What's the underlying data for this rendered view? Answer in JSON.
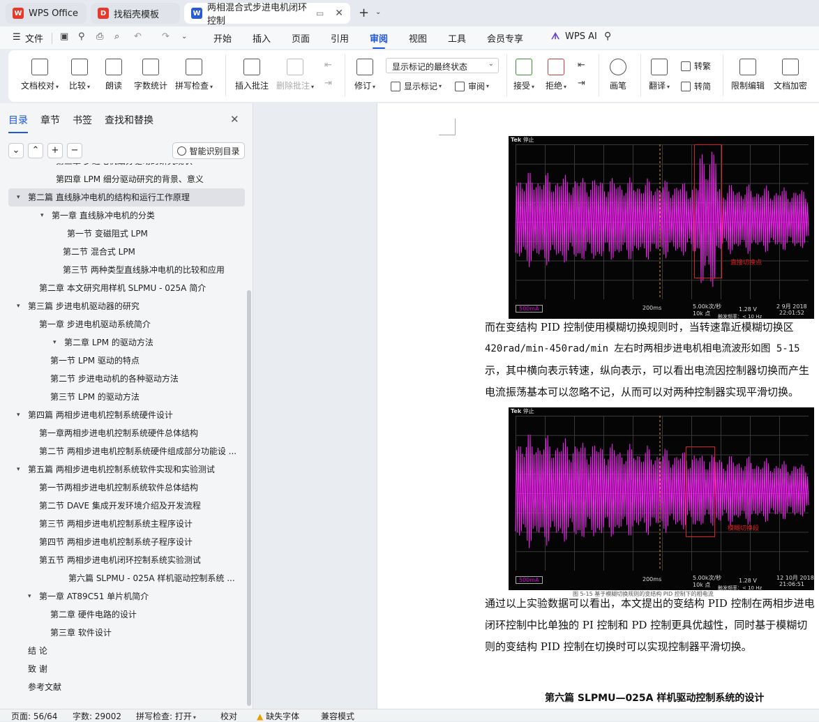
{
  "tabs": [
    {
      "label": "WPS Office",
      "icon": "wps-logo-icon"
    },
    {
      "label": "找稻壳模板",
      "icon": "docer-icon"
    },
    {
      "label": "两相混合式步进电机闭环控制",
      "icon": "writer-icon"
    }
  ],
  "menu": {
    "file": "文件",
    "items": [
      "开始",
      "插入",
      "页面",
      "引用",
      "审阅",
      "视图",
      "工具",
      "会员专享"
    ],
    "active": "审阅",
    "wps_ai": "WPS AI"
  },
  "ribbon": {
    "proofread": "文档校对",
    "compare": "比较",
    "read_aloud": "朗读",
    "word_count": "字数统计",
    "spell_check": "拼写检查",
    "insert_comment": "插入批注",
    "delete_comment": "删除批注",
    "revise": "修订",
    "markup_select": "显示标记的最终状态",
    "show_markup": "显示标记",
    "review": "审阅",
    "accept": "接受",
    "reject": "拒绝",
    "pen": "画笔",
    "translate": "翻译",
    "to_traditional": "转繁",
    "to_simplified": "转简",
    "restrict_edit": "限制编辑",
    "encrypt": "文档加密"
  },
  "nav": {
    "tabs": [
      "目录",
      "章节",
      "书签",
      "查找和替换"
    ],
    "active": "目录",
    "smart_toc": "智能识别目录",
    "controls": [
      "⌄",
      "⌃",
      "+",
      "−"
    ]
  },
  "toc": [
    {
      "text": "第三章   步进电机细分驱动的研究现状",
      "indent": 80,
      "arrow": false
    },
    {
      "text": "第四章   LPM 细分驱动研究的背景、意义",
      "indent": 80,
      "arrow": false
    },
    {
      "text": "第二篇   直线脉冲电机的结构和运行工作原理",
      "indent": 40,
      "arrow": true,
      "selected": true
    },
    {
      "text": "第一章   直线脉冲电机的分类",
      "indent": 74,
      "arrow": true
    },
    {
      "text": "第一节   变磁阻式 LPM",
      "indent": 96,
      "arrow": false
    },
    {
      "text": "第二节   混合式 LPM",
      "indent": 90,
      "arrow": false
    },
    {
      "text": "第三节   两种类型直线脉冲电机的比较和应用",
      "indent": 90,
      "arrow": false
    },
    {
      "text": "第二章   本文研究用样机 SLPMU - 025A 简介",
      "indent": 56,
      "arrow": false
    },
    {
      "text": "第三篇   步进电机驱动器的研究",
      "indent": 40,
      "arrow": true
    },
    {
      "text": "第一章   步进电机驱动系统简介",
      "indent": 56,
      "arrow": false
    },
    {
      "text": "第二章   LPM 的驱动方法",
      "indent": 92,
      "arrow": true
    },
    {
      "text": "第一节   LPM 驱动的特点",
      "indent": 72,
      "arrow": false
    },
    {
      "text": "第二节   步进电动机的各种驱动方法",
      "indent": 72,
      "arrow": false
    },
    {
      "text": "第三节   LPM 的驱动方法",
      "indent": 72,
      "arrow": false
    },
    {
      "text": "第四篇  两相步进电机控制系统硬件设计",
      "indent": 40,
      "arrow": true
    },
    {
      "text": "第一章两相步进电机控制系统硬件总体结构",
      "indent": 56,
      "arrow": false
    },
    {
      "text": "第二节  两相步进电机控制系统硬件组成部分功能设 ...",
      "indent": 56,
      "arrow": false
    },
    {
      "text": "第五篇  两相步进电机控制系统软件实现和实验测试",
      "indent": 40,
      "arrow": true
    },
    {
      "text": "第一节两相步进电机控制系统软件总体结构",
      "indent": 56,
      "arrow": false
    },
    {
      "text": "第二节 DAVE  集成开发环境介绍及开发流程",
      "indent": 56,
      "arrow": false
    },
    {
      "text": "第三节  两相步进电机控制系统主程序设计",
      "indent": 56,
      "arrow": false
    },
    {
      "text": "第四节  两相步进电机控制系统子程序设计",
      "indent": 56,
      "arrow": false
    },
    {
      "text": "第五节  两相步进电机闭环控制系统实验测试",
      "indent": 56,
      "arrow": false
    },
    {
      "text": "第六篇    SLPMU - 025A 样机驱动控制系统 ...",
      "indent": 98,
      "arrow": false
    },
    {
      "text": "第一章    AT89C51 单片机简介",
      "indent": 56,
      "arrow": true
    },
    {
      "text": "第二章    硬件电路的设计",
      "indent": 72,
      "arrow": false
    },
    {
      "text": "第三章    软件设计",
      "indent": 72,
      "arrow": false
    },
    {
      "text": "结   论",
      "indent": 40,
      "arrow": false
    },
    {
      "text": "致   谢",
      "indent": 40,
      "arrow": false
    },
    {
      "text": "参考文献",
      "indent": 40,
      "arrow": false
    }
  ],
  "doc": {
    "scope1": {
      "brand": "Tek",
      "mode": "停止",
      "ch_label": "500mA",
      "time": "200ms",
      "rate": "5.00k次/秒",
      "points": "10k 点",
      "trig_val": "1.28 V",
      "trig_freq": "触发频率：< 10 Hz",
      "date": "2 9月 2018",
      "clock": "22:01:52",
      "annotation": "直接切换点"
    },
    "para1": [
      "而在变结构 PID 控制使用模糊切换规则时，当转速靠近模糊切换区",
      "420rad/min-450rad/min 左右时两相步进电机相电流波形如图 5-15",
      "示，其中横向表示转速，纵向表示，可以看出电流因控制器切换而产生",
      "电流振荡基本可以忽略不记，从而可以对两种控制器实现平滑切换。"
    ],
    "scope2": {
      "brand": "Tek",
      "mode": "停止",
      "ch_label": "500mA",
      "time": "200ms",
      "rate": "5.00k次/秒",
      "points": "10k 点",
      "trig_val": "1.28 V",
      "trig_freq": "触发频率：< 10 Hz",
      "date": "12 10月 2018",
      "clock": "21:06:51",
      "annotation": "模糊切换段"
    },
    "caption2": "图 5-15  基于模糊切换规则的变结构 PID 控制下的相电流",
    "para2": [
      "通过以上实验数据可以看出，本文提出的变结构 PID 控制在两相步进电",
      "闭环控制中比单独的 PI 控制和 PD 控制更具优越性，同时基于模糊切",
      "则的变结构 PID 控制在切换时可以实现控制器平滑切换。"
    ],
    "section_title": "第六篇    SLPMU—025A 样机驱动控制系统的设计"
  },
  "status": {
    "page": "页面: 56/64",
    "words": "字数: 29002",
    "spell": "拼写检查: 打开",
    "proof": "校对",
    "missing_font": "缺失字体",
    "compat": "兼容模式"
  }
}
